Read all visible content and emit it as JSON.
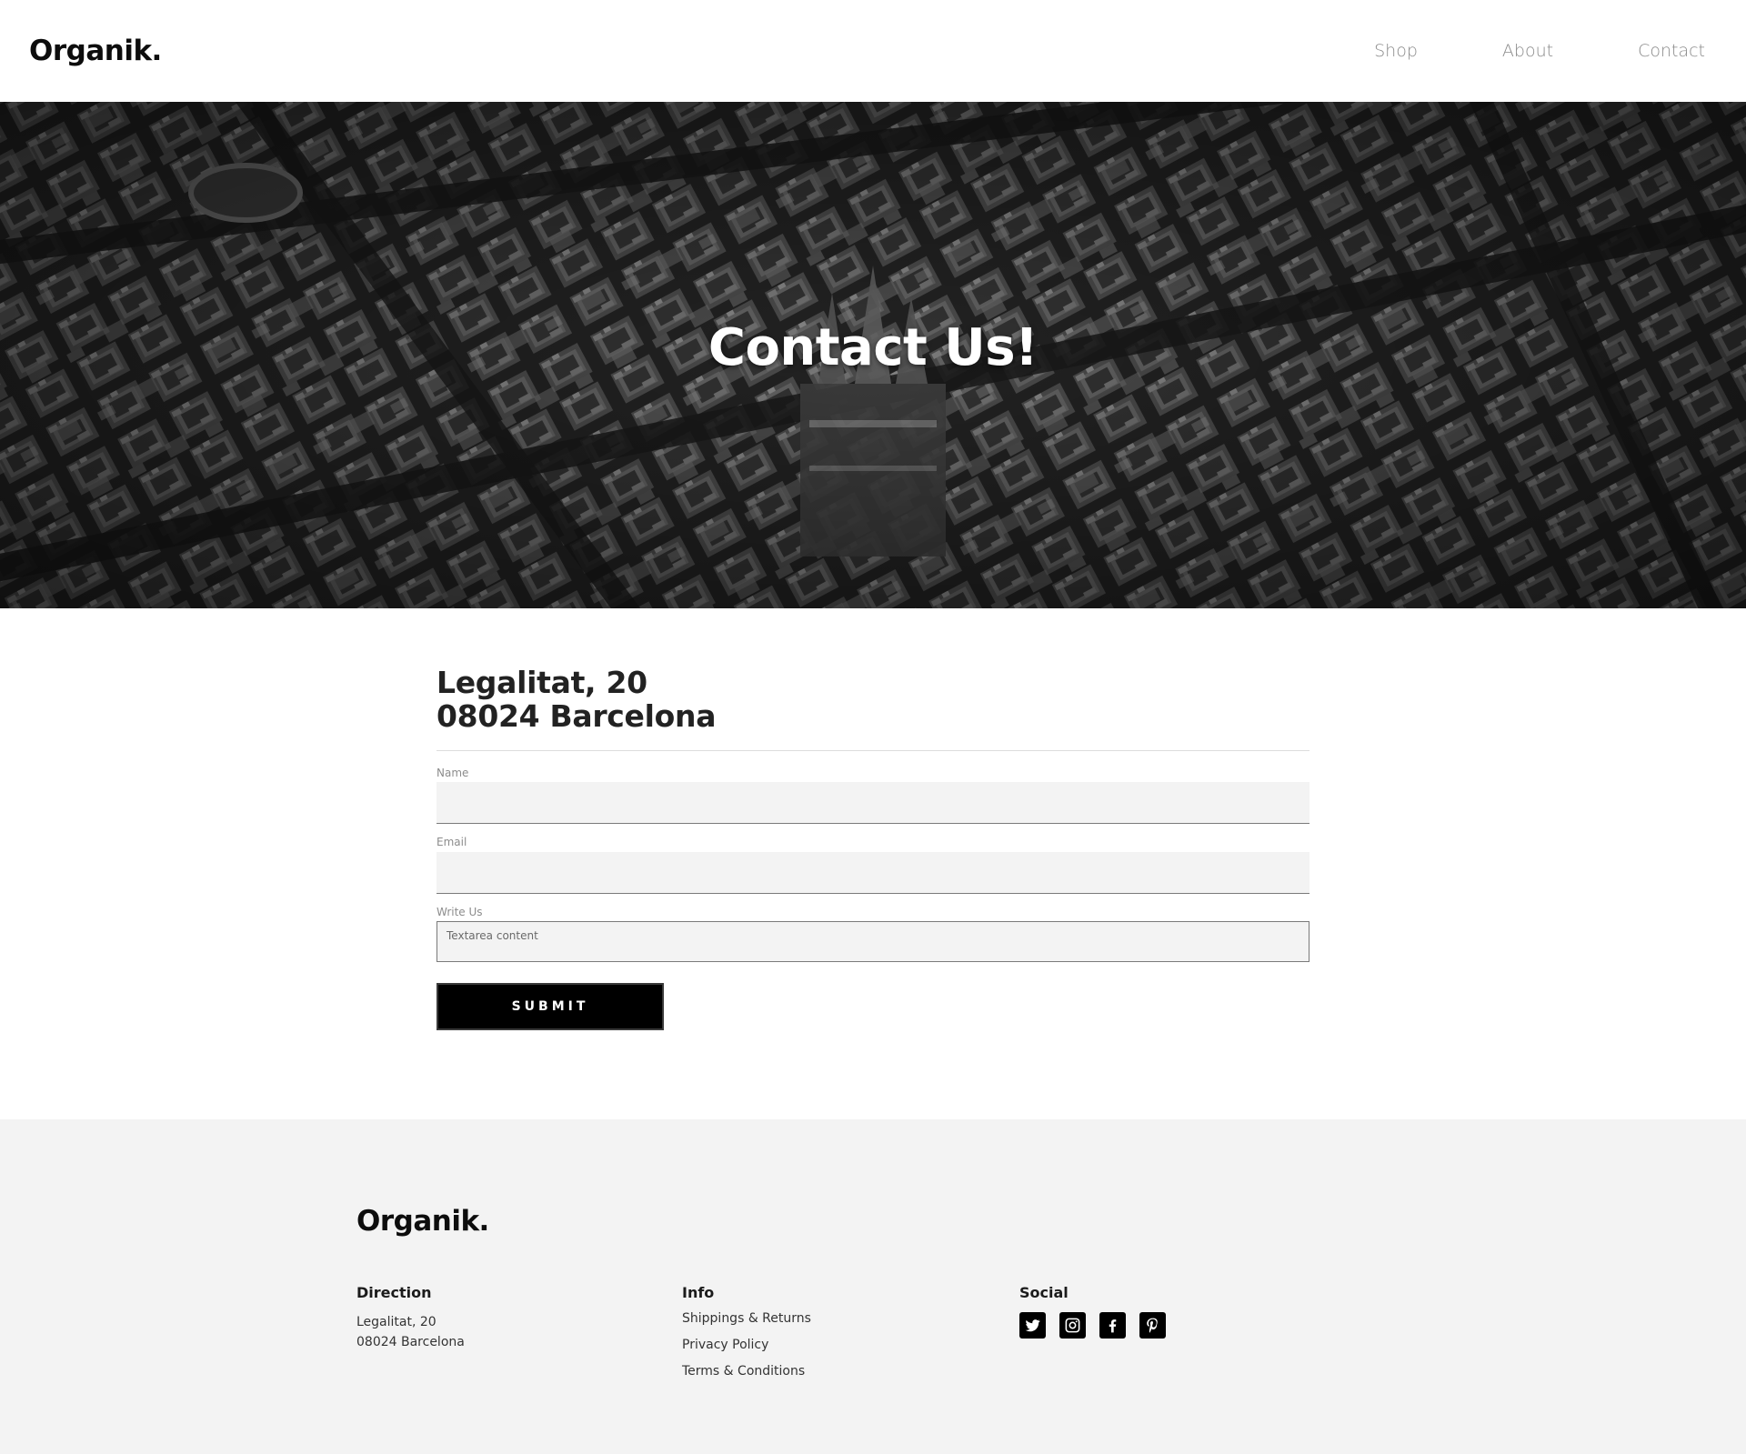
{
  "header": {
    "brand": "Organik.",
    "nav": [
      {
        "label": "Shop"
      },
      {
        "label": "About"
      },
      {
        "label": "Contact"
      }
    ]
  },
  "hero": {
    "title": "Contact Us!"
  },
  "contact": {
    "address_line1": "Legalitat, 20",
    "address_line2": "08024 Barcelona",
    "form": {
      "name_label": "Name",
      "name_value": "",
      "email_label": "Email",
      "email_value": "",
      "message_label": "Write Us",
      "message_value": "Textarea content",
      "submit_label": "SUBMIT"
    }
  },
  "footer": {
    "brand": "Organik.",
    "direction": {
      "title": "Direction",
      "line1": "Legalitat, 20",
      "line2": "08024 Barcelona"
    },
    "info": {
      "title": "Info",
      "links": [
        {
          "label": "Shippings & Returns"
        },
        {
          "label": "Privacy Policy"
        },
        {
          "label": "Terms & Conditions"
        }
      ]
    },
    "social": {
      "title": "Social",
      "icons": [
        "twitter-icon",
        "instagram-icon",
        "facebook-icon",
        "pinterest-icon"
      ]
    }
  }
}
